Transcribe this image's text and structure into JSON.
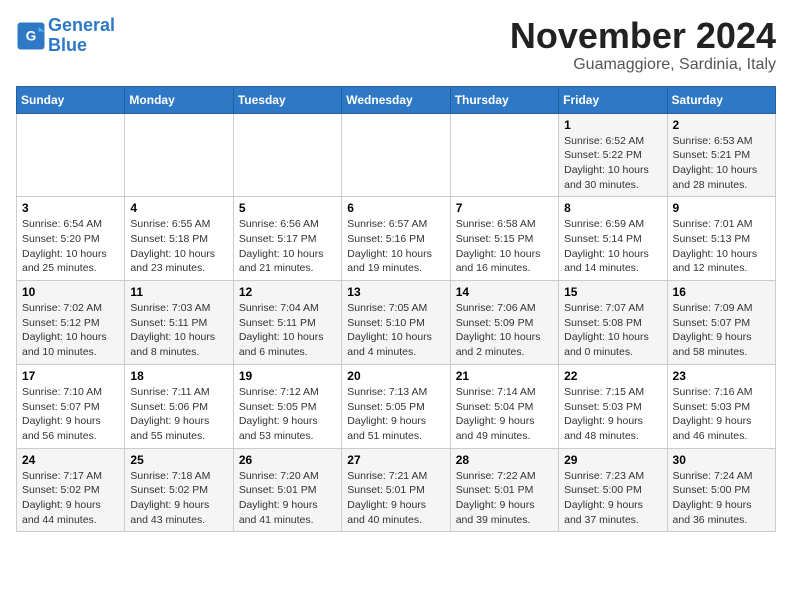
{
  "header": {
    "logo_line1": "General",
    "logo_line2": "Blue",
    "month_title": "November 2024",
    "location": "Guamaggiore, Sardinia, Italy"
  },
  "weekdays": [
    "Sunday",
    "Monday",
    "Tuesday",
    "Wednesday",
    "Thursday",
    "Friday",
    "Saturday"
  ],
  "weeks": [
    [
      {
        "day": "",
        "info": ""
      },
      {
        "day": "",
        "info": ""
      },
      {
        "day": "",
        "info": ""
      },
      {
        "day": "",
        "info": ""
      },
      {
        "day": "",
        "info": ""
      },
      {
        "day": "1",
        "info": "Sunrise: 6:52 AM\nSunset: 5:22 PM\nDaylight: 10 hours and 30 minutes."
      },
      {
        "day": "2",
        "info": "Sunrise: 6:53 AM\nSunset: 5:21 PM\nDaylight: 10 hours and 28 minutes."
      }
    ],
    [
      {
        "day": "3",
        "info": "Sunrise: 6:54 AM\nSunset: 5:20 PM\nDaylight: 10 hours and 25 minutes."
      },
      {
        "day": "4",
        "info": "Sunrise: 6:55 AM\nSunset: 5:18 PM\nDaylight: 10 hours and 23 minutes."
      },
      {
        "day": "5",
        "info": "Sunrise: 6:56 AM\nSunset: 5:17 PM\nDaylight: 10 hours and 21 minutes."
      },
      {
        "day": "6",
        "info": "Sunrise: 6:57 AM\nSunset: 5:16 PM\nDaylight: 10 hours and 19 minutes."
      },
      {
        "day": "7",
        "info": "Sunrise: 6:58 AM\nSunset: 5:15 PM\nDaylight: 10 hours and 16 minutes."
      },
      {
        "day": "8",
        "info": "Sunrise: 6:59 AM\nSunset: 5:14 PM\nDaylight: 10 hours and 14 minutes."
      },
      {
        "day": "9",
        "info": "Sunrise: 7:01 AM\nSunset: 5:13 PM\nDaylight: 10 hours and 12 minutes."
      }
    ],
    [
      {
        "day": "10",
        "info": "Sunrise: 7:02 AM\nSunset: 5:12 PM\nDaylight: 10 hours and 10 minutes."
      },
      {
        "day": "11",
        "info": "Sunrise: 7:03 AM\nSunset: 5:11 PM\nDaylight: 10 hours and 8 minutes."
      },
      {
        "day": "12",
        "info": "Sunrise: 7:04 AM\nSunset: 5:11 PM\nDaylight: 10 hours and 6 minutes."
      },
      {
        "day": "13",
        "info": "Sunrise: 7:05 AM\nSunset: 5:10 PM\nDaylight: 10 hours and 4 minutes."
      },
      {
        "day": "14",
        "info": "Sunrise: 7:06 AM\nSunset: 5:09 PM\nDaylight: 10 hours and 2 minutes."
      },
      {
        "day": "15",
        "info": "Sunrise: 7:07 AM\nSunset: 5:08 PM\nDaylight: 10 hours and 0 minutes."
      },
      {
        "day": "16",
        "info": "Sunrise: 7:09 AM\nSunset: 5:07 PM\nDaylight: 9 hours and 58 minutes."
      }
    ],
    [
      {
        "day": "17",
        "info": "Sunrise: 7:10 AM\nSunset: 5:07 PM\nDaylight: 9 hours and 56 minutes."
      },
      {
        "day": "18",
        "info": "Sunrise: 7:11 AM\nSunset: 5:06 PM\nDaylight: 9 hours and 55 minutes."
      },
      {
        "day": "19",
        "info": "Sunrise: 7:12 AM\nSunset: 5:05 PM\nDaylight: 9 hours and 53 minutes."
      },
      {
        "day": "20",
        "info": "Sunrise: 7:13 AM\nSunset: 5:05 PM\nDaylight: 9 hours and 51 minutes."
      },
      {
        "day": "21",
        "info": "Sunrise: 7:14 AM\nSunset: 5:04 PM\nDaylight: 9 hours and 49 minutes."
      },
      {
        "day": "22",
        "info": "Sunrise: 7:15 AM\nSunset: 5:03 PM\nDaylight: 9 hours and 48 minutes."
      },
      {
        "day": "23",
        "info": "Sunrise: 7:16 AM\nSunset: 5:03 PM\nDaylight: 9 hours and 46 minutes."
      }
    ],
    [
      {
        "day": "24",
        "info": "Sunrise: 7:17 AM\nSunset: 5:02 PM\nDaylight: 9 hours and 44 minutes."
      },
      {
        "day": "25",
        "info": "Sunrise: 7:18 AM\nSunset: 5:02 PM\nDaylight: 9 hours and 43 minutes."
      },
      {
        "day": "26",
        "info": "Sunrise: 7:20 AM\nSunset: 5:01 PM\nDaylight: 9 hours and 41 minutes."
      },
      {
        "day": "27",
        "info": "Sunrise: 7:21 AM\nSunset: 5:01 PM\nDaylight: 9 hours and 40 minutes."
      },
      {
        "day": "28",
        "info": "Sunrise: 7:22 AM\nSunset: 5:01 PM\nDaylight: 9 hours and 39 minutes."
      },
      {
        "day": "29",
        "info": "Sunrise: 7:23 AM\nSunset: 5:00 PM\nDaylight: 9 hours and 37 minutes."
      },
      {
        "day": "30",
        "info": "Sunrise: 7:24 AM\nSunset: 5:00 PM\nDaylight: 9 hours and 36 minutes."
      }
    ]
  ]
}
